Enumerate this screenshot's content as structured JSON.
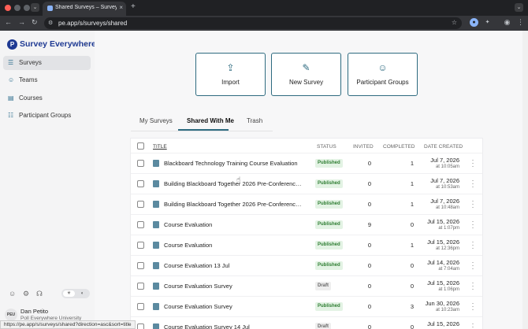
{
  "browser": {
    "tab_title": "Shared Surveys – Survey Eve",
    "tab_close": "×",
    "new_tab": "+",
    "url": "pe.app/s/surveys/shared",
    "back": "←",
    "forward": "→",
    "reload": "↻",
    "star": "☆",
    "tab_drop": "⌄",
    "status_url": "https://pe.app/s/surveys/shared?direction=asc&sort=title"
  },
  "sidebar": {
    "brand": "Survey Everywhere",
    "items": [
      {
        "label": "Surveys",
        "icon": "☰",
        "active": true
      },
      {
        "label": "Teams",
        "icon": "☺",
        "active": false
      },
      {
        "label": "Courses",
        "icon": "▤",
        "active": false
      },
      {
        "label": "Participant Groups",
        "icon": "☷",
        "active": false
      }
    ],
    "user_initials": "PEU",
    "user_name": "Dan Petito",
    "user_org": "Poll Everywhere University"
  },
  "actions": [
    {
      "label": "Import",
      "icon": "⇪"
    },
    {
      "label": "New Survey",
      "icon": "✎"
    },
    {
      "label": "Participant Groups",
      "icon": "☺"
    }
  ],
  "tabs": [
    {
      "label": "My Surveys"
    },
    {
      "label": "Shared With Me"
    },
    {
      "label": "Trash"
    }
  ],
  "table": {
    "columns": {
      "title": "TITLE",
      "status": "STATUS",
      "invited": "INVITED",
      "completed": "COMPLETED",
      "date": "DATE CREATED"
    },
    "rows": [
      {
        "title": "Blackboard Technology Training Course Evaluation",
        "status": "Published",
        "invited": "0",
        "completed": "1",
        "date": "Jul 7, 2026",
        "time": "at 10:05am"
      },
      {
        "title": "Building Blackboard Together 2026 Pre-Conference...",
        "status": "Published",
        "invited": "0",
        "completed": "1",
        "date": "Jul 7, 2026",
        "time": "at 10:53am"
      },
      {
        "title": "Building Blackboard Together 2026 Pre-Conference...",
        "status": "Published",
        "invited": "0",
        "completed": "1",
        "date": "Jul 7, 2026",
        "time": "at 10:48am"
      },
      {
        "title": "Course Evaluation",
        "status": "Published",
        "invited": "9",
        "completed": "0",
        "date": "Jul 15, 2026",
        "time": "at 1:07pm"
      },
      {
        "title": "Course Evaluation",
        "status": "Published",
        "invited": "0",
        "completed": "1",
        "date": "Jul 15, 2026",
        "time": "at 12:36pm"
      },
      {
        "title": "Course Evaluation 13 Jul",
        "status": "Published",
        "invited": "0",
        "completed": "0",
        "date": "Jul 14, 2026",
        "time": "at 7:04am"
      },
      {
        "title": "Course Evaluation Survey",
        "status": "Draft",
        "invited": "0",
        "completed": "0",
        "date": "Jul 15, 2026",
        "time": "at 1:06pm"
      },
      {
        "title": "Course Evaluation Survey",
        "status": "Published",
        "invited": "0",
        "completed": "3",
        "date": "Jun 30, 2026",
        "time": "at 10:23am"
      },
      {
        "title": "Course Evaluation Survey 14 Jul",
        "status": "Draft",
        "invited": "0",
        "completed": "0",
        "date": "Jul 15, 2026",
        "time": ""
      }
    ]
  }
}
